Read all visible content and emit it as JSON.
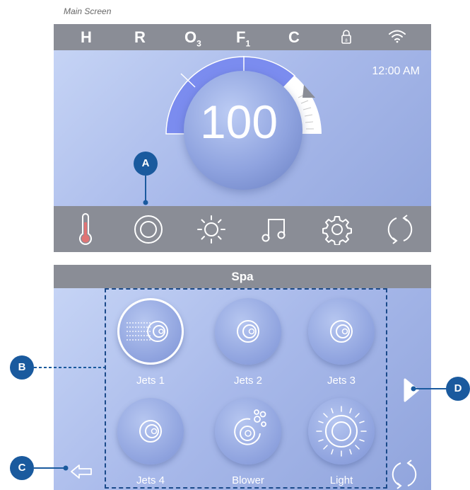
{
  "caption": "Main Screen",
  "status_bar": {
    "indicators": [
      "H",
      "R",
      "O",
      "F",
      "C"
    ],
    "o_sub": "3",
    "f_sub": "1",
    "icons": [
      "lock-icon",
      "wifi-icon"
    ]
  },
  "clock": "12:00 AM",
  "temperature": "100",
  "bottom_nav": [
    "thermometer-icon",
    "spa-ring-icon",
    "light-sun-icon",
    "music-note-icon",
    "gear-icon",
    "refresh-icon"
  ],
  "spa": {
    "title": "Spa",
    "tiles": [
      {
        "label": "Jets 1",
        "icon": "jets-icon",
        "active": true
      },
      {
        "label": "Jets 2",
        "icon": "jets-icon",
        "active": false
      },
      {
        "label": "Jets 3",
        "icon": "jets-icon",
        "active": false
      },
      {
        "label": "Jets 4",
        "icon": "jets-icon",
        "active": false
      },
      {
        "label": "Blower",
        "icon": "blower-icon",
        "active": false
      },
      {
        "label": "Light",
        "icon": "light-icon",
        "active": false
      }
    ]
  },
  "callouts": {
    "a": "A",
    "b": "B",
    "c": "C",
    "d": "D"
  },
  "colors": {
    "accent": "#1a5a9e",
    "bar": "#8a8d96",
    "gauge": "#7b8cef",
    "thermo": "#e07575"
  }
}
